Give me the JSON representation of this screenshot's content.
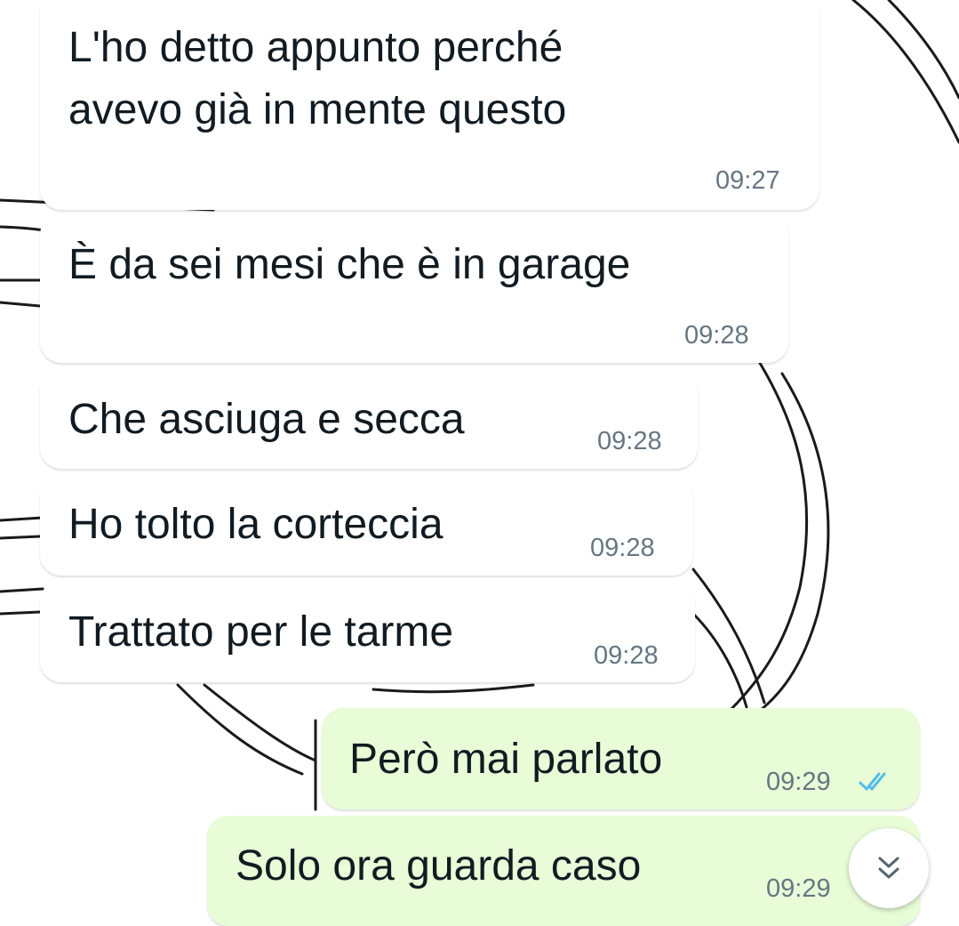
{
  "messages": [
    {
      "direction": "incoming",
      "lines": [
        "L'ho detto appunto perché",
        "avevo già in mente questo"
      ],
      "time": "09:27"
    },
    {
      "direction": "incoming",
      "lines": [
        "È da sei mesi che è in garage"
      ],
      "time": "09:28"
    },
    {
      "direction": "incoming",
      "lines": [
        "Che asciuga e secca"
      ],
      "time": "09:28"
    },
    {
      "direction": "incoming",
      "lines": [
        "Ho tolto la corteccia"
      ],
      "time": "09:28"
    },
    {
      "direction": "incoming",
      "lines": [
        "Trattato per le tarme"
      ],
      "time": "09:28"
    },
    {
      "direction": "outgoing",
      "lines": [
        "Però mai parlato"
      ],
      "time": "09:29",
      "status": "read"
    },
    {
      "direction": "outgoing",
      "lines": [
        "Solo ora guarda caso"
      ],
      "time": "09:29",
      "status": "read"
    }
  ],
  "scroll_button": {
    "icon": "double-chevron-down-icon"
  },
  "colors": {
    "incoming_bubble": "#ffffff",
    "outgoing_bubble": "#e7fcd7",
    "text": "#111b21",
    "timestamp": "#667781",
    "read_ticks": "#53bdeb"
  }
}
